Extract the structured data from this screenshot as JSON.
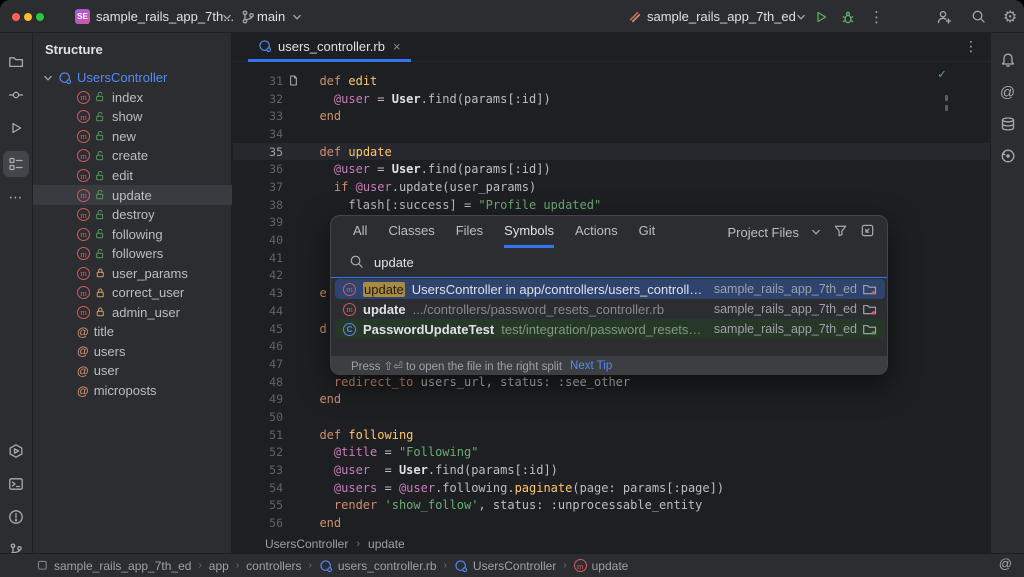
{
  "colors": {
    "accent": "#3574f0",
    "selection_blue": "#2e436e",
    "panel": "#2b2d30",
    "editor_bg": "#1e1f22",
    "keyword": "#cf8e6d",
    "method_name": "#ffc66d",
    "ivar": "#c77dbb",
    "string": "#6aab73",
    "match_highlight": "#a98a3e",
    "run_green": "#5fad65",
    "error_red": "#d45b5b"
  },
  "title_bar": {
    "project_name": "sample_rails_app_7th...",
    "project_badge": "SE",
    "branch": "main",
    "run_config": "sample_rails_app_7th_ed"
  },
  "left_strip": {
    "top": [
      "folder",
      "commit",
      "run",
      "structure",
      "more"
    ],
    "bottom": [
      "services",
      "terminal",
      "problems",
      "git-branch"
    ],
    "selected": "structure"
  },
  "right_strip": [
    "bell",
    "ai-assistant",
    "database",
    "endpoints"
  ],
  "structure_panel": {
    "title": "Structure",
    "root": "UsersController",
    "items": [
      {
        "label": "index",
        "kind": "method",
        "lock": "public"
      },
      {
        "label": "show",
        "kind": "method",
        "lock": "public"
      },
      {
        "label": "new",
        "kind": "method",
        "lock": "public"
      },
      {
        "label": "create",
        "kind": "method",
        "lock": "public"
      },
      {
        "label": "edit",
        "kind": "method",
        "lock": "public"
      },
      {
        "label": "update",
        "kind": "method",
        "lock": "public",
        "selected": true
      },
      {
        "label": "destroy",
        "kind": "method",
        "lock": "public"
      },
      {
        "label": "following",
        "kind": "method",
        "lock": "public"
      },
      {
        "label": "followers",
        "kind": "method",
        "lock": "public"
      },
      {
        "label": "user_params",
        "kind": "method",
        "lock": "private"
      },
      {
        "label": "correct_user",
        "kind": "method",
        "lock": "private"
      },
      {
        "label": "admin_user",
        "kind": "method",
        "lock": "private"
      },
      {
        "label": "title",
        "kind": "field"
      },
      {
        "label": "users",
        "kind": "field"
      },
      {
        "label": "user",
        "kind": "field"
      },
      {
        "label": "microposts",
        "kind": "field"
      }
    ]
  },
  "editor": {
    "tab_label": "users_controller.rb",
    "lines": [
      {
        "n": 31,
        "bookmark": true,
        "t": [
          [
            "  ",
            ""
          ],
          [
            "def",
            "k"
          ],
          [
            " ",
            ""
          ],
          [
            "edit",
            "f"
          ]
        ]
      },
      {
        "n": 32,
        "t": [
          [
            "    ",
            ""
          ],
          [
            "@user",
            "v"
          ],
          [
            " = ",
            ""
          ],
          [
            "User",
            "c"
          ],
          [
            ".find(params[:id])",
            ""
          ]
        ]
      },
      {
        "n": 33,
        "t": [
          [
            "  ",
            ""
          ],
          [
            "end",
            "k"
          ]
        ]
      },
      {
        "n": 34,
        "t": []
      },
      {
        "n": 35,
        "current": true,
        "t": [
          [
            "  ",
            ""
          ],
          [
            "def",
            "k"
          ],
          [
            " ",
            ""
          ],
          [
            "update",
            "f"
          ]
        ]
      },
      {
        "n": 36,
        "t": [
          [
            "    ",
            ""
          ],
          [
            "@user",
            "v"
          ],
          [
            " = ",
            ""
          ],
          [
            "User",
            "c"
          ],
          [
            ".find(params[:id])",
            ""
          ]
        ]
      },
      {
        "n": 37,
        "t": [
          [
            "    ",
            ""
          ],
          [
            "if",
            "k"
          ],
          [
            " ",
            ""
          ],
          [
            "@user",
            "v"
          ],
          [
            ".update(user_params)",
            ""
          ]
        ]
      },
      {
        "n": 38,
        "t": [
          [
            "      flash[:success] = ",
            ""
          ],
          [
            "\"Profile updated\"",
            "s"
          ]
        ]
      },
      {
        "n": 39,
        "t": []
      },
      {
        "n": 40,
        "t": []
      },
      {
        "n": 41,
        "t": []
      },
      {
        "n": 42,
        "t": []
      },
      {
        "n": 43,
        "t": [
          [
            "  ",
            ""
          ],
          [
            "e",
            "k"
          ]
        ]
      },
      {
        "n": 44,
        "t": []
      },
      {
        "n": 45,
        "t": [
          [
            "  ",
            ""
          ],
          [
            "d",
            "k"
          ]
        ]
      },
      {
        "n": 46,
        "t": []
      },
      {
        "n": 47,
        "t": []
      },
      {
        "n": 48,
        "t": [
          [
            "    ",
            ""
          ],
          [
            "redirect_to",
            "k"
          ],
          [
            " users_url, status: :see_other",
            ""
          ]
        ]
      },
      {
        "n": 49,
        "t": [
          [
            "  ",
            ""
          ],
          [
            "end",
            "k"
          ]
        ]
      },
      {
        "n": 50,
        "t": []
      },
      {
        "n": 51,
        "t": [
          [
            "  ",
            ""
          ],
          [
            "def",
            "k"
          ],
          [
            " ",
            ""
          ],
          [
            "following",
            "f"
          ]
        ]
      },
      {
        "n": 52,
        "t": [
          [
            "    ",
            ""
          ],
          [
            "@title",
            "v"
          ],
          [
            " = ",
            ""
          ],
          [
            "\"Following\"",
            "s"
          ]
        ]
      },
      {
        "n": 53,
        "t": [
          [
            "    ",
            ""
          ],
          [
            "@user",
            "v"
          ],
          [
            "  = ",
            ""
          ],
          [
            "User",
            "c"
          ],
          [
            ".find(params[:id])",
            ""
          ]
        ]
      },
      {
        "n": 54,
        "t": [
          [
            "    ",
            ""
          ],
          [
            "@users",
            "v"
          ],
          [
            " = ",
            ""
          ],
          [
            "@user",
            "v"
          ],
          [
            ".following.",
            ""
          ],
          [
            "paginate",
            "f"
          ],
          [
            "(page: params[:page])",
            ""
          ]
        ]
      },
      {
        "n": 55,
        "t": [
          [
            "    ",
            ""
          ],
          [
            "render",
            "k"
          ],
          [
            " ",
            ""
          ],
          [
            "'show_follow'",
            "s"
          ],
          [
            ", status: :unprocessable_entity",
            ""
          ]
        ]
      },
      {
        "n": 56,
        "t": [
          [
            "  ",
            ""
          ],
          [
            "end",
            "k"
          ]
        ]
      }
    ],
    "breadcrumbs": [
      "UsersController",
      "update"
    ]
  },
  "popup": {
    "tabs": [
      "All",
      "Classes",
      "Files",
      "Symbols",
      "Actions",
      "Git"
    ],
    "selected_tab": "Symbols",
    "scope": "Project Files",
    "query": "update",
    "results": [
      {
        "kind": "method",
        "match": "update",
        "desc": "UsersController in app/controllers/users_controller.rb",
        "module": "sample_rails_app_7th_ed",
        "selected": true,
        "dot": "red"
      },
      {
        "kind": "method",
        "name": "update",
        "desc": ".../controllers/password_resets_controller.rb",
        "module": "sample_rails_app_7th_ed",
        "dot": "red"
      },
      {
        "kind": "class",
        "name": "PasswordUpdateTest",
        "desc": "test/integration/password_resets_test.rb",
        "module": "sample_rails_app_7th_ed",
        "test": true,
        "dot": "green"
      }
    ],
    "hint": "Press ⇧⏎ to open the file in the right split",
    "hint_link": "Next Tip"
  },
  "nav_bar": {
    "items": [
      {
        "icon": "module",
        "label": "sample_rails_app_7th_ed"
      },
      {
        "label": "app"
      },
      {
        "label": "controllers"
      },
      {
        "icon": "class",
        "label": "users_controller.rb"
      },
      {
        "icon": "class",
        "label": "UsersController"
      },
      {
        "icon": "method",
        "label": "update"
      }
    ]
  }
}
